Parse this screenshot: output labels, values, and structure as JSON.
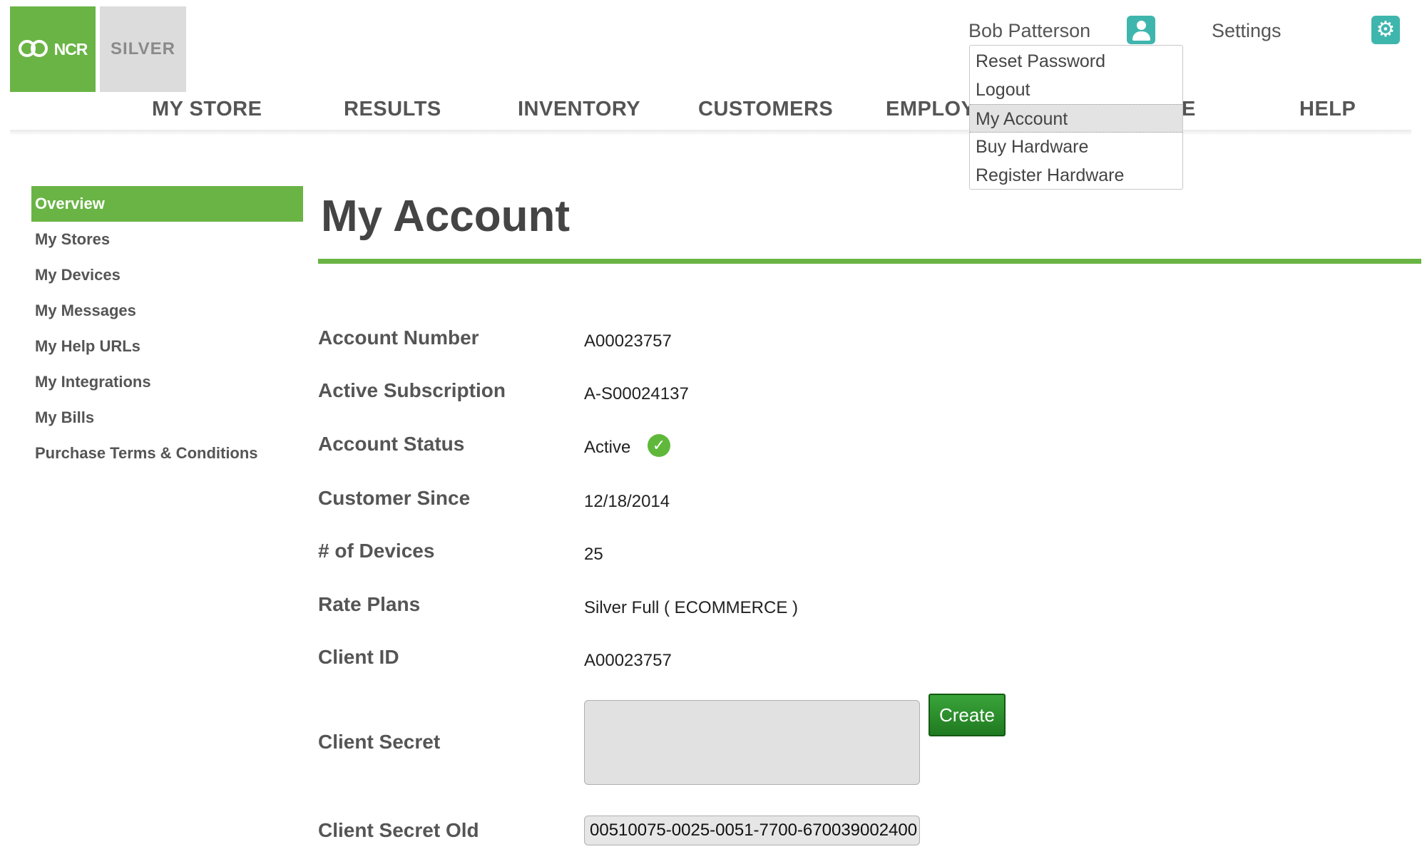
{
  "logos": {
    "ncr": "NCR",
    "silver": "SILVER"
  },
  "user": {
    "name": "Bob Patterson",
    "icon": "user-icon"
  },
  "settings": {
    "label": "Settings",
    "icon": "gear-icon"
  },
  "nav": [
    "MY STORE",
    "RESULTS",
    "INVENTORY",
    "CUSTOMERS",
    "EMPLOY",
    "E",
    "HELP"
  ],
  "dropdown": {
    "items": [
      "Reset Password",
      "Logout",
      "My Account",
      "Buy Hardware",
      "Register Hardware"
    ],
    "active": "My Account"
  },
  "sidebar": {
    "items": [
      "Overview",
      "My Stores",
      "My Devices",
      "My Messages",
      "My Help URLs",
      "My Integrations",
      "My Bills",
      "Purchase Terms & Conditions"
    ],
    "active": "Overview"
  },
  "main": {
    "title": "My Account",
    "fields": [
      {
        "label": "Account Number",
        "value": "A00023757"
      },
      {
        "label": "Active Subscription",
        "value": "A-S00024137"
      },
      {
        "label": "Account Status",
        "value": "Active"
      },
      {
        "label": "Customer Since",
        "value": "12/18/2014"
      },
      {
        "label": "# of Devices",
        "value": "25"
      },
      {
        "label": "Rate Plans",
        "value": "Silver Full ( ECOMMERCE )"
      },
      {
        "label": "Client ID",
        "value": "A00023757"
      }
    ],
    "client_secret": {
      "label": "Client Secret",
      "value": "",
      "button": "Create"
    },
    "client_secret_old": {
      "label": "Client Secret Old",
      "value": "00510075-0025-0051-7700-670039002400"
    }
  },
  "colors": {
    "brand_green": "#6ab445",
    "teal": "#3fb6ad",
    "button_green": "#2a8f2a"
  }
}
